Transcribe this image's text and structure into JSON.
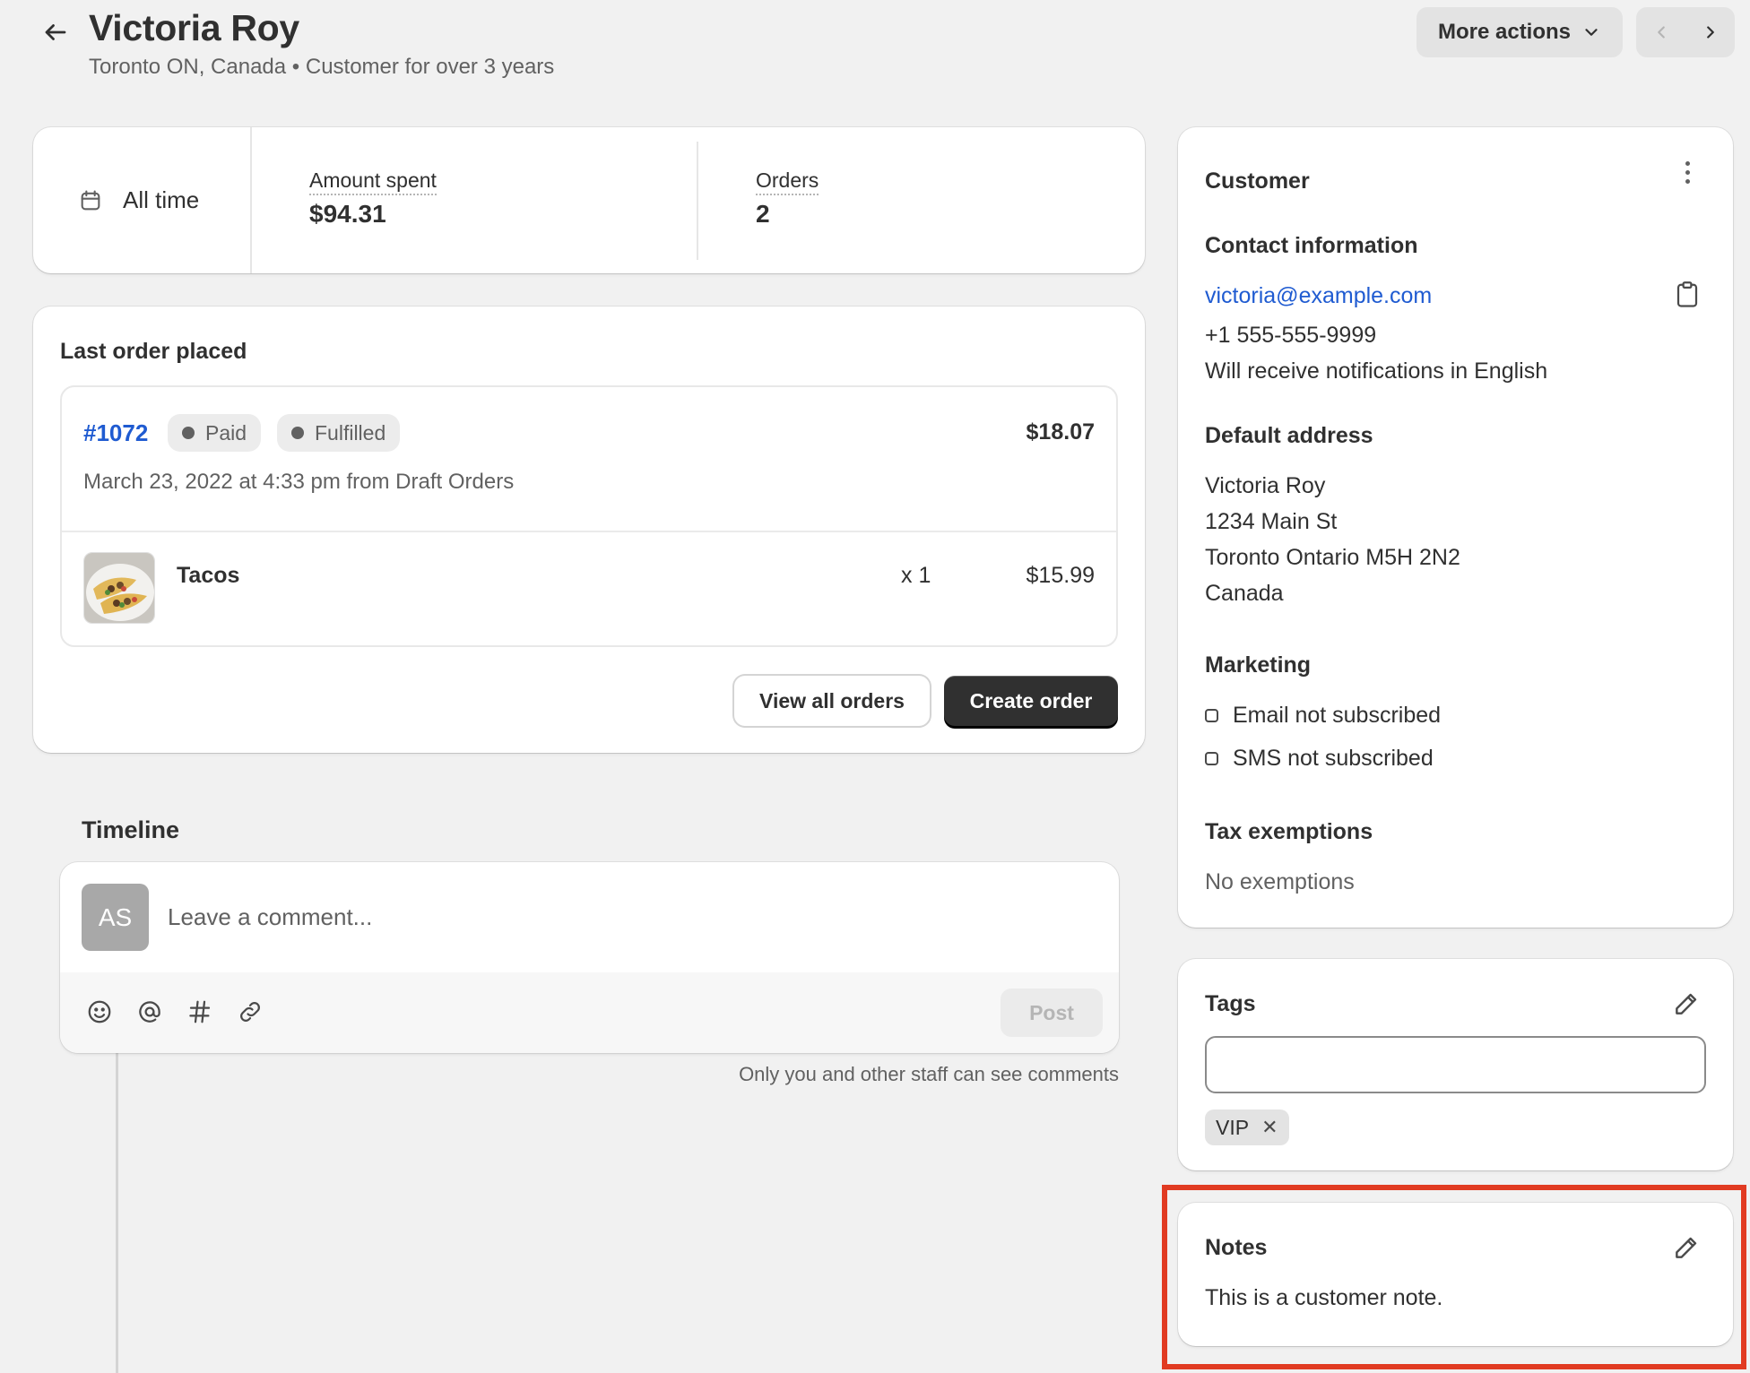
{
  "header": {
    "title": "Victoria Roy",
    "subtitle": "Toronto ON, Canada • Customer for over 3 years",
    "more_actions_label": "More actions"
  },
  "stats": {
    "range_label": "All time",
    "amount_spent_label": "Amount spent",
    "amount_spent_value": "$94.31",
    "orders_label": "Orders",
    "orders_value": "2"
  },
  "last_order": {
    "title": "Last order placed",
    "order_number": "#1072",
    "badges": [
      "Paid",
      "Fulfilled"
    ],
    "total": "$18.07",
    "date": "March 23, 2022 at 4:33 pm from Draft Orders",
    "item": {
      "name": "Tacos",
      "qty": "x 1",
      "price": "$15.99"
    },
    "view_all_label": "View all orders",
    "create_label": "Create order"
  },
  "timeline": {
    "title": "Timeline",
    "avatar_initials": "AS",
    "comment_placeholder": "Leave a comment...",
    "post_label": "Post",
    "staff_note": "Only you and other staff can see comments",
    "toolbar_icons": [
      "emoji-icon",
      "mention-icon",
      "hashtag-icon",
      "link-icon"
    ]
  },
  "customer": {
    "title": "Customer",
    "contact_title": "Contact information",
    "email": "victoria@example.com",
    "phone": "+1 555-555-9999",
    "language_note": "Will receive notifications in English",
    "address_title": "Default address",
    "address_lines": [
      "Victoria Roy",
      "1234 Main St",
      "Toronto Ontario M5H 2N2",
      "Canada"
    ],
    "marketing_title": "Marketing",
    "marketing": [
      "Email not subscribed",
      "SMS not subscribed"
    ],
    "tax_title": "Tax exemptions",
    "tax_value": "No exemptions"
  },
  "tags": {
    "title": "Tags",
    "input_value": "",
    "items": [
      "VIP"
    ]
  },
  "notes": {
    "title": "Notes",
    "body": "This is a customer note."
  },
  "colors": {
    "link": "#1f5bd1",
    "primary_button": "#303030",
    "highlight": "#e13b22",
    "background": "#f1f1f1"
  }
}
